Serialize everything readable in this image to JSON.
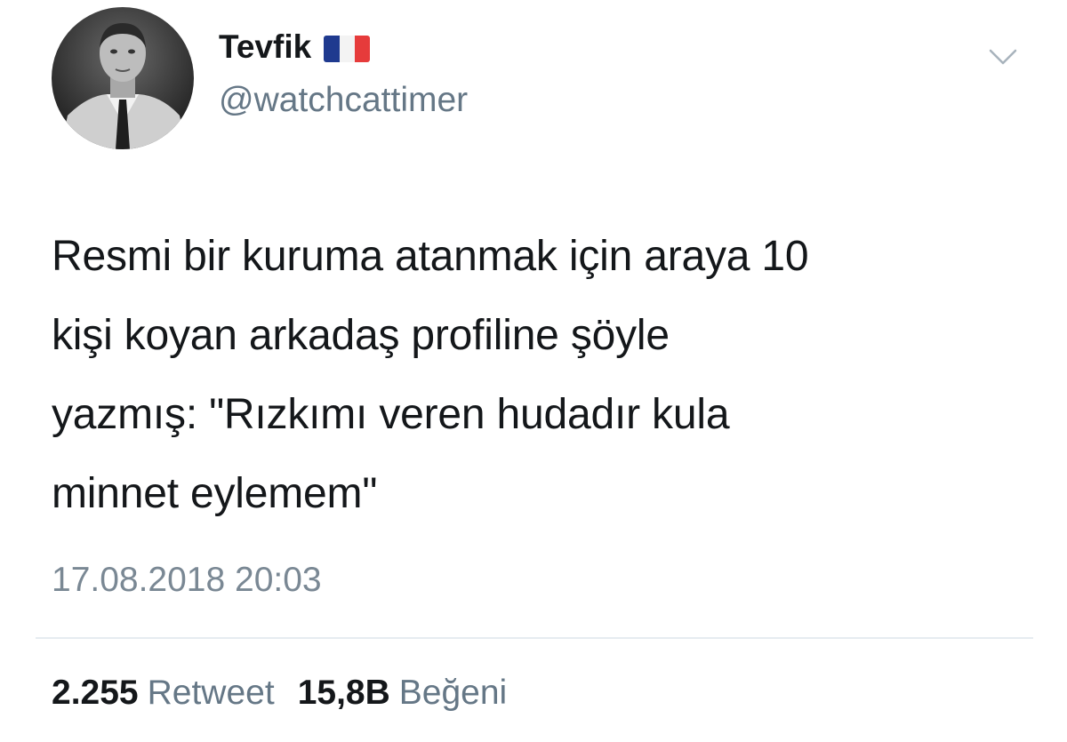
{
  "profile": {
    "display_name": "Tevfik",
    "flag_icon": "france-flag-icon",
    "handle": "@watchcattimer"
  },
  "tweet": {
    "text": "Resmi bir kuruma atanmak için araya 10\nkişi koyan arkadaş profiline şöyle\nyazmış: \"Rızkımı veren hudadır kula\nminnet eylemem\"",
    "timestamp": "17.08.2018 20:03"
  },
  "stats": {
    "retweets": {
      "count": "2.255",
      "label": "Retweet"
    },
    "likes": {
      "count": "15,8B",
      "label": "Beğeni"
    }
  },
  "colors": {
    "text_primary": "#14171a",
    "text_secondary": "#657786",
    "divider": "#e6ecf0"
  },
  "icons": {
    "menu": "chevron-down-icon"
  }
}
